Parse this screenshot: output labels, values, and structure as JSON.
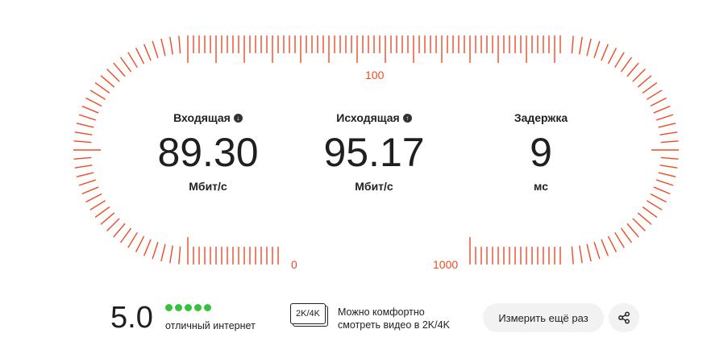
{
  "gauge": {
    "accent_color": "#f04a23",
    "scale_labels": {
      "zero": "0",
      "hundred": "100",
      "thousand": "1000"
    }
  },
  "metrics": {
    "download": {
      "label": "Входящая",
      "value": "89.30",
      "unit": "Мбит/с",
      "icon": "arrow-down-icon"
    },
    "upload": {
      "label": "Исходящая",
      "value": "95.17",
      "unit": "Мбит/с",
      "icon": "arrow-up-icon"
    },
    "latency": {
      "label": "Задержка",
      "value": "9",
      "unit": "мс"
    }
  },
  "rating": {
    "value": "5.0",
    "dots_color": "#36c23a",
    "text": "отличный интернет"
  },
  "video": {
    "badge": "2K/4K",
    "line1": "Можно комфортно",
    "line2": "смотреть видео в 2K/4K"
  },
  "actions": {
    "retry_label": "Измерить ещё раз",
    "share_icon": "share-icon"
  }
}
